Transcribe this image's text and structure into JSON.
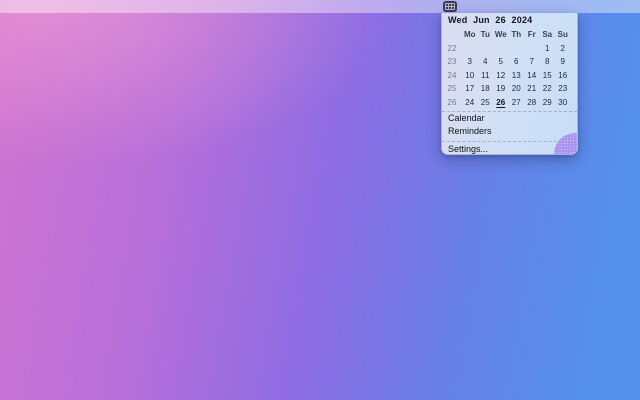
{
  "menubar": {
    "tray_icon": "calendar-grid-icon"
  },
  "panel": {
    "header": "Wed Jun 26 2024",
    "day_headers": [
      "Mo",
      "Tu",
      "We",
      "Th",
      "Fr",
      "Sa",
      "Su"
    ],
    "weeks": [
      {
        "week": "22",
        "days": [
          "",
          "",
          "",
          "",
          "",
          "1",
          "2"
        ]
      },
      {
        "week": "23",
        "days": [
          "3",
          "4",
          "5",
          "6",
          "7",
          "8",
          "9"
        ]
      },
      {
        "week": "24",
        "days": [
          "10",
          "11",
          "12",
          "13",
          "14",
          "15",
          "16"
        ]
      },
      {
        "week": "25",
        "days": [
          "17",
          "18",
          "19",
          "20",
          "21",
          "22",
          "23"
        ]
      },
      {
        "week": "26",
        "days": [
          "24",
          "25",
          "26",
          "27",
          "28",
          "29",
          "30"
        ]
      }
    ],
    "selected_date": "26",
    "menu_items": {
      "calendar": "Calendar",
      "reminders": "Reminders",
      "settings": "Settings..."
    }
  },
  "colors": {
    "wallpaper_pink": "#cf74d0",
    "wallpaper_violet": "#8c6ce3",
    "wallpaper_blue": "#5590ec",
    "panel_bg": "#cfe0f6",
    "blob_purple": "#ab92ee",
    "tray_icon_bg": "#3e3852"
  }
}
